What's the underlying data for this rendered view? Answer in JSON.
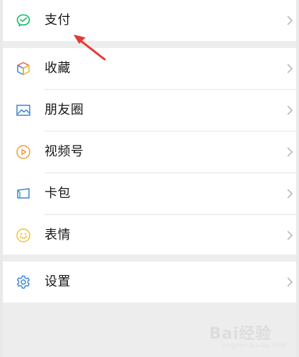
{
  "menu": {
    "pay": {
      "label": "支付",
      "icon": "wechat-pay-icon"
    },
    "items": [
      {
        "label": "收藏",
        "icon": "favorites-cube-icon"
      },
      {
        "label": "朋友圈",
        "icon": "moments-image-icon"
      },
      {
        "label": "视频号",
        "icon": "channels-play-icon"
      },
      {
        "label": "卡包",
        "icon": "card-wallet-icon"
      },
      {
        "label": "表情",
        "icon": "sticker-smiley-icon"
      }
    ],
    "settings": {
      "label": "设置",
      "icon": "gear-icon"
    }
  },
  "watermark": {
    "brand": "Bai经验",
    "sub": "jingyan.baidu.com"
  },
  "colors": {
    "pay_green": "#07c160",
    "accent_blue": "#3b82d6",
    "channels_orange": "#f29c38",
    "sticker_yellow": "#f5c226",
    "arrow_red": "#e53935"
  }
}
